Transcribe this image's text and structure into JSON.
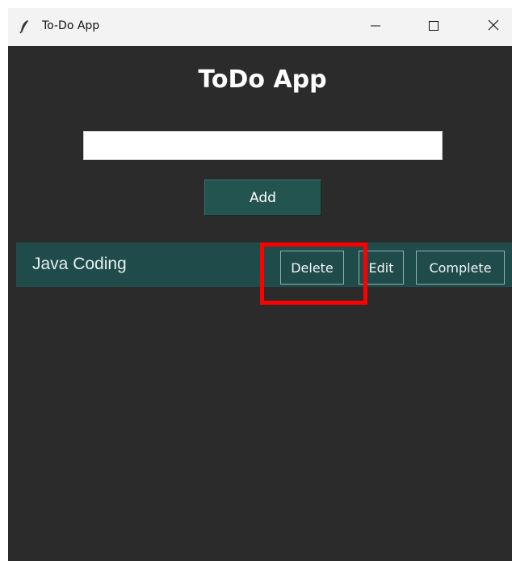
{
  "window": {
    "title": "To-Do App",
    "icon": "feather-icon",
    "controls": {
      "minimize": "minimize-icon",
      "maximize": "maximize-icon",
      "close": "close-icon"
    }
  },
  "app": {
    "heading": "ToDo App",
    "input": {
      "value": "",
      "placeholder": ""
    },
    "add_label": "Add"
  },
  "tasks": [
    {
      "label": "Java Coding",
      "delete_label": "Delete",
      "edit_label": "Edit",
      "complete_label": "Complete"
    }
  ],
  "colors": {
    "background": "#2b2b2b",
    "accent": "#235450",
    "task_row": "#1f4b4a",
    "highlight": "#ff0000"
  }
}
